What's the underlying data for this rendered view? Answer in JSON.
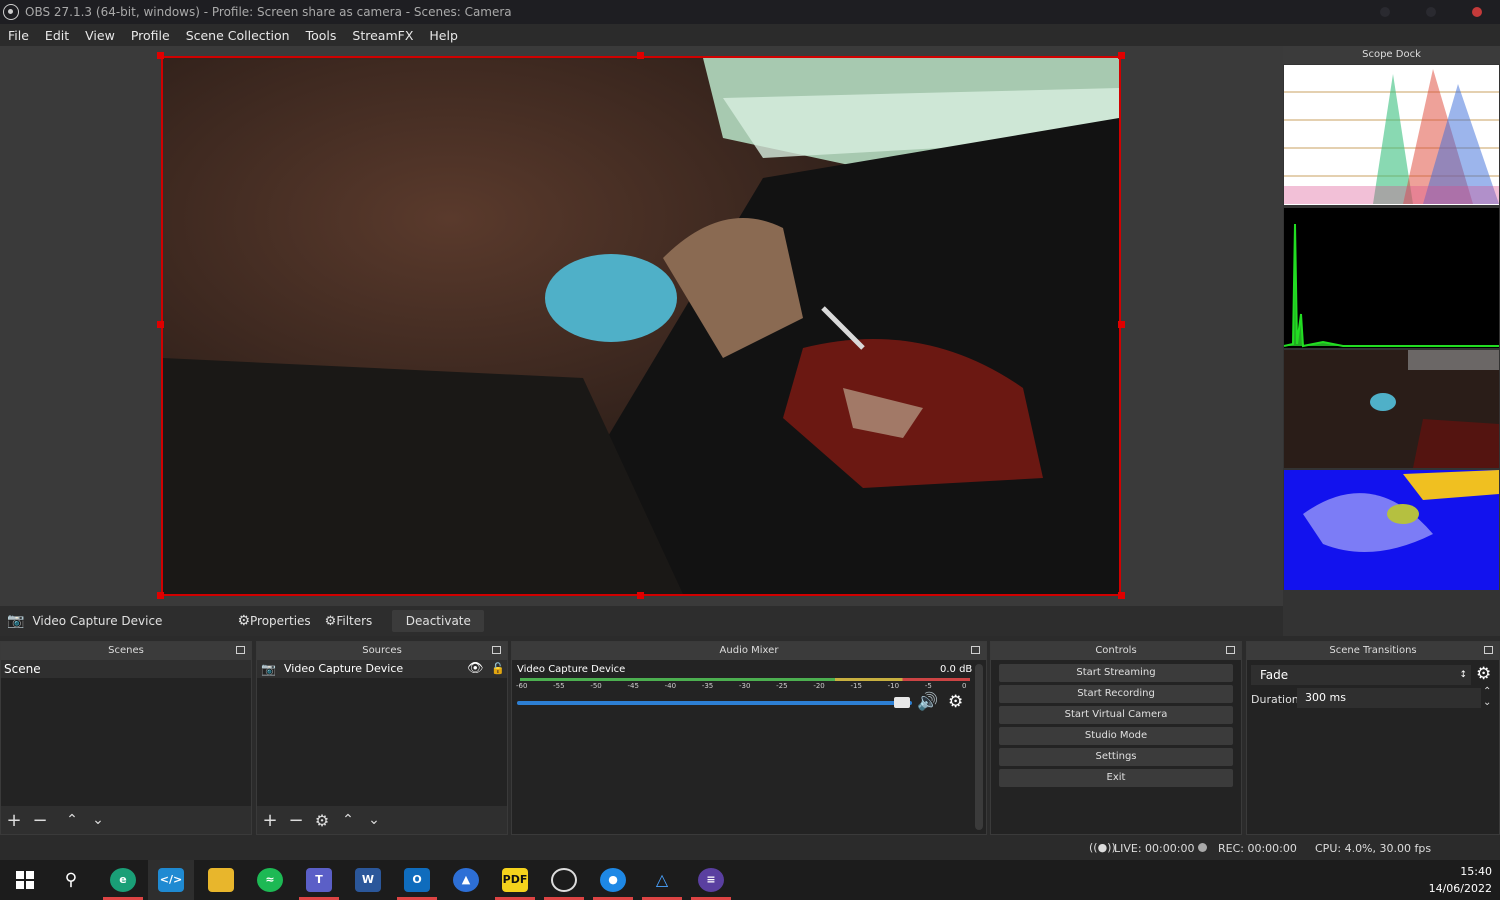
{
  "window": {
    "title": "OBS 27.1.3 (64-bit, windows) - Profile: Screen share as camera - Scenes: Camera"
  },
  "menu": [
    "File",
    "Edit",
    "View",
    "Profile",
    "Scene Collection",
    "Tools",
    "StreamFX",
    "Help"
  ],
  "scope_dock": {
    "title": "Scope Dock"
  },
  "source_toolbar": {
    "source_name": "Video Capture Device",
    "properties_label": "Properties",
    "filters_label": "Filters",
    "deactivate_label": "Deactivate"
  },
  "scenes": {
    "title": "Scenes",
    "items": [
      "Scene"
    ]
  },
  "sources": {
    "title": "Sources",
    "items": [
      "Video Capture Device"
    ]
  },
  "audio_mixer": {
    "title": "Audio Mixer",
    "channel_name": "Video Capture Device",
    "db": "0.0 dB",
    "ticks": [
      "-60",
      "-55",
      "-50",
      "-45",
      "-40",
      "-35",
      "-30",
      "-25",
      "-20",
      "-15",
      "-10",
      "-5",
      "0"
    ],
    "volume_fraction": 1.0
  },
  "controls": {
    "title": "Controls",
    "buttons": [
      "Start Streaming",
      "Start Recording",
      "Start Virtual Camera",
      "Studio Mode",
      "Settings",
      "Exit"
    ]
  },
  "transitions": {
    "title": "Scene Transitions",
    "selected": "Fade",
    "duration_label": "Duration",
    "duration_value": "300 ms"
  },
  "status": {
    "live": "LIVE: 00:00:00",
    "rec": "REC: 00:00:00",
    "cpu": "CPU: 4.0%, 30.00 fps"
  },
  "clock": {
    "time": "15:40",
    "date": "14/06/2022"
  },
  "colors": {
    "accent_red": "#d00000",
    "meter_green": "#4caf50",
    "slider_blue": "#2d7fd3"
  }
}
